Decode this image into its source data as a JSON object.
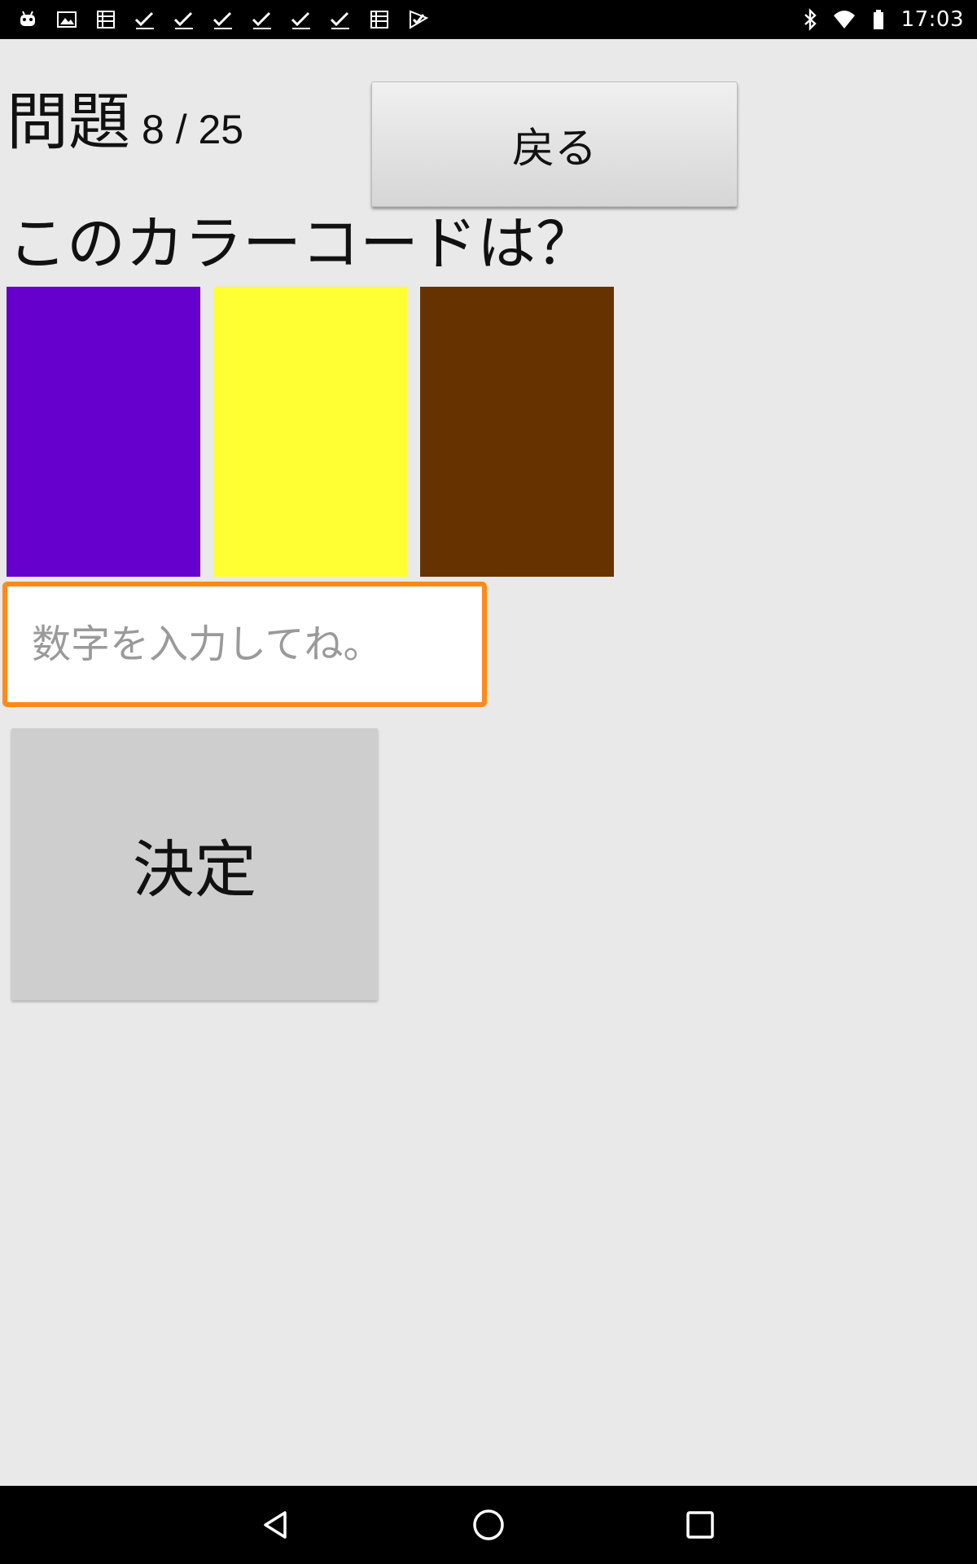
{
  "status_bar": {
    "time": "17:03",
    "left_icons": [
      "android-icon",
      "image-icon",
      "storage-icon",
      "checkmark-icon",
      "checkmark-icon",
      "checkmark-icon",
      "checkmark-icon",
      "checkmark-icon",
      "checkmark-icon",
      "storage-icon",
      "checkmark-flag-icon"
    ],
    "right_icons": [
      "bluetooth-icon",
      "wifi-icon",
      "battery-icon"
    ]
  },
  "header": {
    "question_label": "問題",
    "progress": "8 / 25",
    "back_button_label": "戻る"
  },
  "prompt": "このカラーコードは？",
  "swatches": [
    {
      "name": "purple",
      "color": "#6600cc"
    },
    {
      "name": "yellow",
      "color": "#ffff33"
    },
    {
      "name": "brown",
      "color": "#663300"
    }
  ],
  "answer": {
    "placeholder": "数字を入力してね。",
    "value": ""
  },
  "decide_button_label": "決定",
  "colors": {
    "background": "#e9e9e9",
    "input_focus_border": "#ff8a1a"
  },
  "nav_bar": {
    "buttons": [
      "back-icon",
      "home-icon",
      "recents-icon"
    ]
  }
}
